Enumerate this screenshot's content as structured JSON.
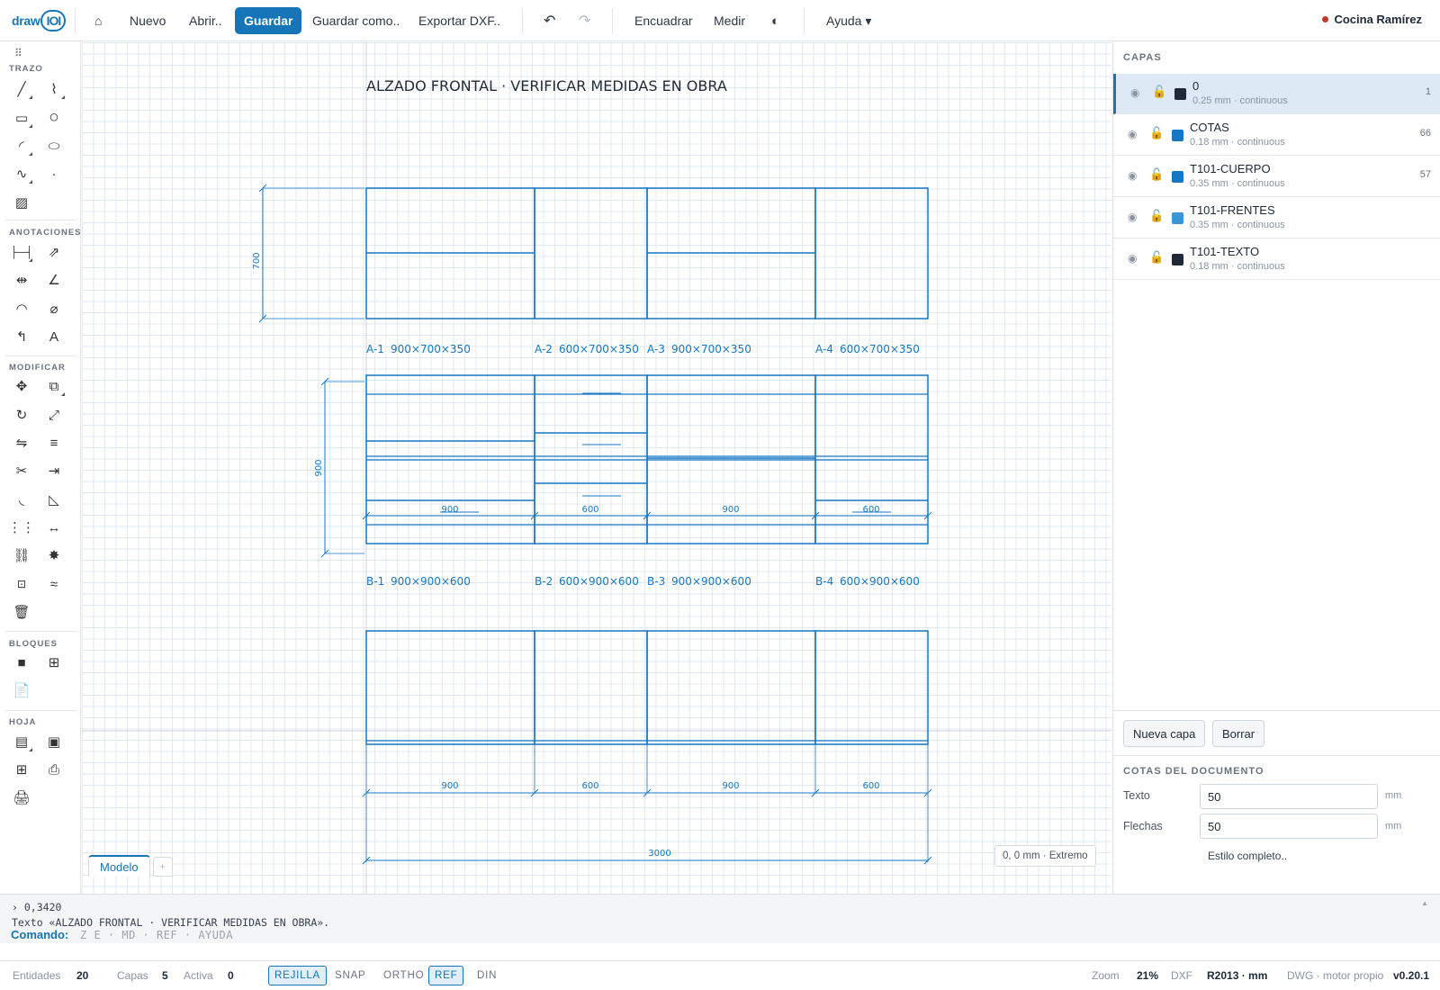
{
  "topbar": {
    "logo_word": "draw",
    "logo_badge": "IOI",
    "home_icon": "home-icon",
    "new_label": "Nuevo",
    "open_label": "Abrir..",
    "save_label": "Guardar",
    "save_as_label": "Guardar como..",
    "export_label": "Exportar DXF..",
    "undo_icon": "undo-icon",
    "redo_icon": "redo-icon",
    "fit_label": "Encuadrar",
    "measure_label": "Medir",
    "theme_icon": "contrast-icon",
    "help_label": "Ayuda ▾",
    "project_name": "Cocina Ramírez",
    "project_status_color": "#c0392b"
  },
  "toolbox": {
    "sections": {
      "trazo": "TRAZO",
      "anotaciones": "ANOTACIONES",
      "modificar": "MODIFICAR",
      "bloques": "BLOQUES",
      "hoja": "HOJA"
    }
  },
  "drawing": {
    "title_text": "ALZADO FRONTAL · VERIFICAR MEDIDAS EN OBRA",
    "upper_height": "700",
    "base_height": "900",
    "upper_units": [
      {
        "code": "A-1",
        "dims": "900×700×350"
      },
      {
        "code": "A-2",
        "dims": "600×700×350"
      },
      {
        "code": "A-3",
        "dims": "900×700×350"
      },
      {
        "code": "A-4",
        "dims": "600×700×350"
      }
    ],
    "base_units": [
      {
        "code": "B-1",
        "dims": "900×900×600"
      },
      {
        "code": "B-2",
        "dims": "600×900×600"
      },
      {
        "code": "B-3",
        "dims": "900×900×600"
      },
      {
        "code": "B-4",
        "dims": "600×900×600"
      }
    ],
    "base_widths": [
      "900",
      "600",
      "900",
      "600"
    ],
    "plan_widths": [
      "900",
      "600",
      "900",
      "600"
    ],
    "total_width": "3000",
    "line_color": "#1677c4"
  },
  "canvas": {
    "coord_readout": "0, 0 mm · Extremo",
    "tab_model": "Modelo",
    "tab_add": "+"
  },
  "layers_panel": {
    "title": "CAPAS",
    "layers": [
      {
        "name": "0",
        "meta": "0.25 mm · continuous",
        "count": "1",
        "color": "#1f2937"
      },
      {
        "name": "COTAS",
        "meta": "0.18 mm · continuous",
        "count": "66",
        "color": "#1677c4"
      },
      {
        "name": "T101-CUERPO",
        "meta": "0.35 mm · continuous",
        "count": "57",
        "color": "#1677c4"
      },
      {
        "name": "T101-FRENTES",
        "meta": "0.35 mm · continuous",
        "count": "",
        "color": "#3a97d6"
      },
      {
        "name": "T101-TEXTO",
        "meta": "0.18 mm · continuous",
        "count": "",
        "color": "#1f2937"
      }
    ],
    "new_layer_label": "Nueva capa",
    "delete_label": "Borrar"
  },
  "doc_dims": {
    "title": "COTAS DEL DOCUMENTO",
    "text_label": "Texto",
    "text_value": "50",
    "arrows_label": "Flechas",
    "arrows_value": "50",
    "unit": "mm",
    "full_style_link": "Estilo completo.."
  },
  "command": {
    "history_1": "› 0,3420",
    "history_2": "Texto «ALZADO FRONTAL · VERIFICAR MEDIDAS EN OBRA».",
    "prompt_label": "Comando:",
    "hint": "Z E · MD · REF · AYUDA"
  },
  "status": {
    "entities_label": "Entidades",
    "entities_value": "20",
    "layers_label": "Capas",
    "layers_value": "5",
    "active_label": "Activa",
    "active_value": "0",
    "toggles": [
      {
        "label": "REJILLA",
        "on": true
      },
      {
        "label": "SNAP",
        "on": false
      },
      {
        "label": "ORTHO",
        "on": false
      },
      {
        "label": "REF",
        "on": true
      },
      {
        "label": "DIN",
        "on": false
      }
    ],
    "zoom_label": "Zoom",
    "zoom_value": "21%",
    "format_label": "DXF",
    "format_value": "R2013 · mm",
    "engine_label": "DWG · motor propio",
    "version": "v0.20.1"
  }
}
